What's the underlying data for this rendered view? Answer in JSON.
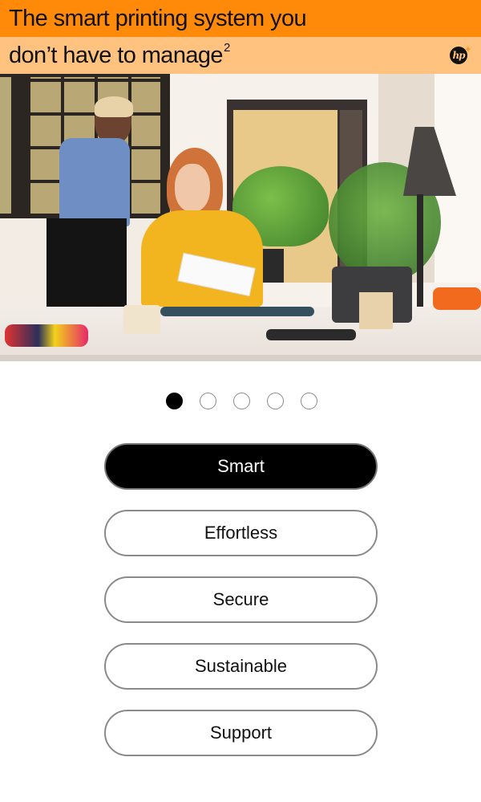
{
  "header": {
    "headline_line1": "The smart printing system you",
    "headline_line2": "don’t have to manage",
    "footnote_marker": "2",
    "logo_text": "hp",
    "logo_plus": "+",
    "colors": {
      "primary_band": "#ff8a0a",
      "secondary_band": "#ffc27f"
    }
  },
  "hero": {
    "icon": "office-photo",
    "description": "Two women reviewing a printout at an office desk with plants, a desk lamp, and a phone"
  },
  "carousel": {
    "total_slides": 5,
    "active_index": 0
  },
  "menu": {
    "items": [
      {
        "label": "Smart",
        "active": true
      },
      {
        "label": "Effortless",
        "active": false
      },
      {
        "label": "Secure",
        "active": false
      },
      {
        "label": "Sustainable",
        "active": false
      },
      {
        "label": "Support",
        "active": false
      }
    ]
  }
}
